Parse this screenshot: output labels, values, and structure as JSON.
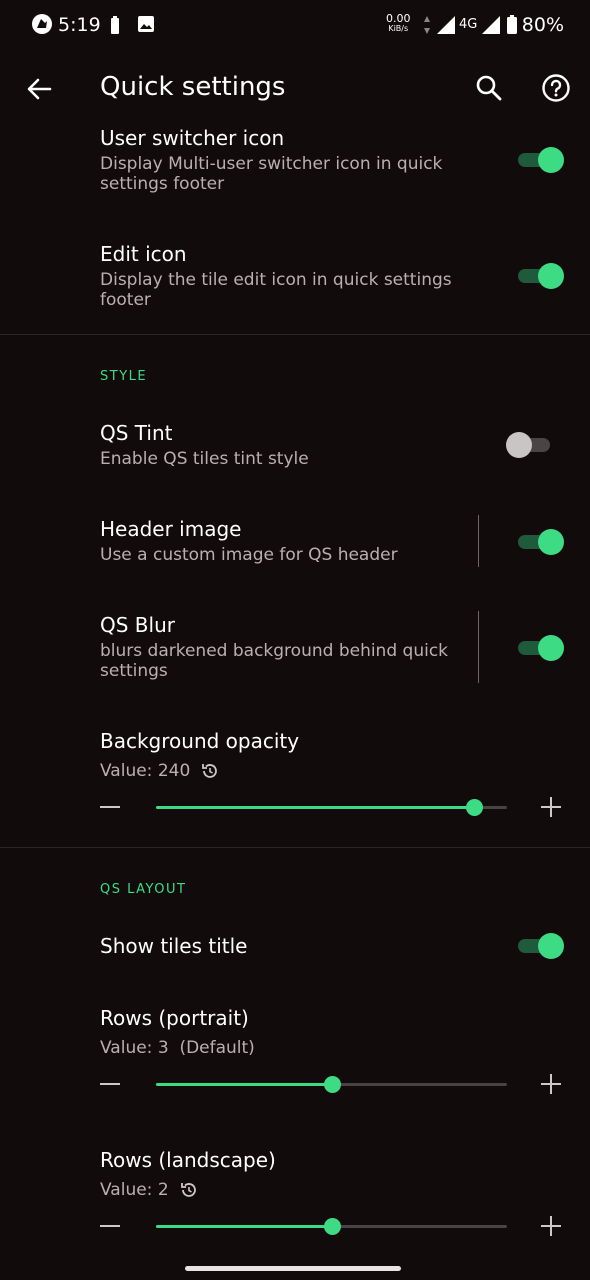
{
  "status_bar": {
    "time": "5:19",
    "speed_value": "0.00",
    "speed_unit": "KiB/s",
    "network": "4G",
    "battery": "80%"
  },
  "app_bar": {
    "title": "Quick settings",
    "back_icon": "arrow-back-icon",
    "search_icon": "search-icon",
    "help_icon": "help-icon"
  },
  "items": {
    "user_switcher": {
      "title": "User switcher icon",
      "subtitle": "Display Multi-user switcher icon in quick settings footer",
      "enabled": true
    },
    "edit_icon": {
      "title": "Edit icon",
      "subtitle": "Display the tile edit icon in quick settings footer",
      "enabled": true
    },
    "qs_tint": {
      "title": "QS Tint",
      "subtitle": "Enable QS tiles tint style",
      "enabled": false
    },
    "header_image": {
      "title": "Header image",
      "subtitle": "Use a custom image for QS header",
      "enabled": true
    },
    "qs_blur": {
      "title": "QS Blur",
      "subtitle": "blurs darkened background behind quick settings",
      "enabled": true
    },
    "background_opacity": {
      "title": "Background opacity",
      "value_text": "Value: 240",
      "fraction": 0.906
    },
    "show_tiles_title": {
      "title": "Show tiles title",
      "enabled": true
    },
    "rows_portrait": {
      "title": "Rows (portrait)",
      "value_text": "Value: 3  (Default)",
      "fraction": 0.5
    },
    "rows_landscape": {
      "title": "Rows (landscape)",
      "value_text": "Value: 2",
      "fraction": 0.5
    }
  },
  "sections": {
    "style": "STYLE",
    "qs_layout": "QS LAYOUT"
  },
  "colors": {
    "accent": "#3ddc84",
    "background": "#120b0c"
  }
}
